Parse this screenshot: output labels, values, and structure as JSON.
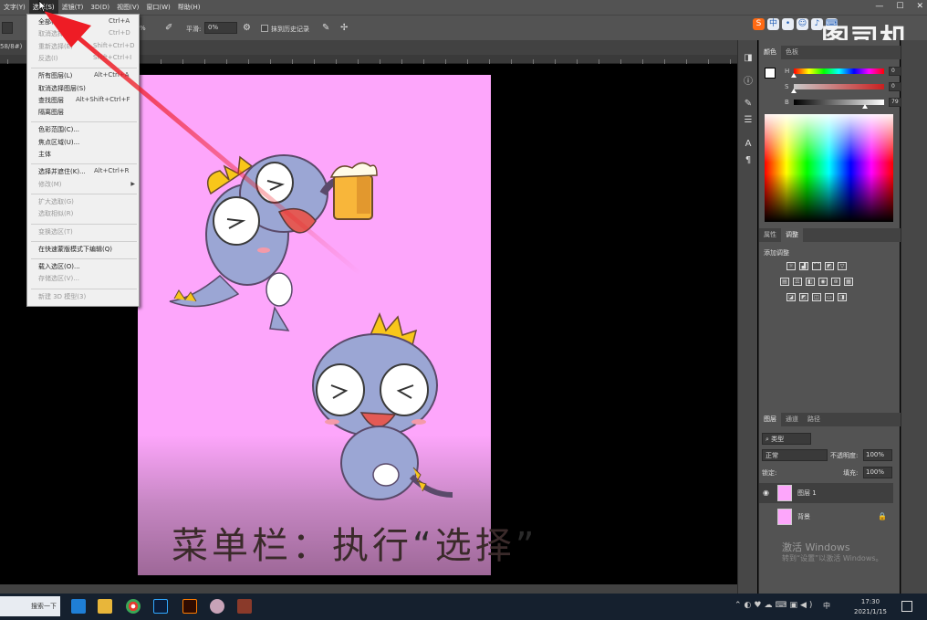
{
  "menubar": {
    "items": [
      "文字(Y)",
      "选择(S)",
      "滤镜(T)",
      "3D(D)",
      "视图(V)",
      "窗口(W)",
      "帮助(H)"
    ],
    "active_index": 1
  },
  "window_controls": [
    "—",
    "☐",
    "✕"
  ],
  "options_bar": {
    "percent_suffix": "%",
    "smoothing_label": "平滑:",
    "smoothing_value": "0%",
    "history_label": "抹到历史记录"
  },
  "doc_tab": "58/8#)",
  "watermark": "图司机",
  "select_menu": {
    "groups": [
      [
        {
          "label": "全部(A)",
          "shortcut": "Ctrl+A",
          "disabled": false
        },
        {
          "label": "取消选择(D)",
          "shortcut": "Ctrl+D",
          "disabled": true
        },
        {
          "label": "重新选择(E)",
          "shortcut": "Shift+Ctrl+D",
          "disabled": true
        },
        {
          "label": "反选(I)",
          "shortcut": "Shift+Ctrl+I",
          "disabled": true
        }
      ],
      [
        {
          "label": "所有图层(L)",
          "shortcut": "Alt+Ctrl+A",
          "disabled": false
        },
        {
          "label": "取消选择图层(S)",
          "shortcut": "",
          "disabled": false
        },
        {
          "label": "查找图层",
          "shortcut": "Alt+Shift+Ctrl+F",
          "disabled": false
        },
        {
          "label": "隔离图层",
          "shortcut": "",
          "disabled": false
        }
      ],
      [
        {
          "label": "色彩范围(C)...",
          "shortcut": "",
          "disabled": false
        },
        {
          "label": "焦点区域(U)...",
          "shortcut": "",
          "disabled": false
        },
        {
          "label": "主体",
          "shortcut": "",
          "disabled": false
        }
      ],
      [
        {
          "label": "选择并遮住(K)...",
          "shortcut": "Alt+Ctrl+R",
          "disabled": false
        },
        {
          "label": "修改(M)",
          "shortcut": "",
          "disabled": true,
          "submenu": true
        }
      ],
      [
        {
          "label": "扩大选取(G)",
          "shortcut": "",
          "disabled": true
        },
        {
          "label": "选取相似(R)",
          "shortcut": "",
          "disabled": true
        }
      ],
      [
        {
          "label": "变换选区(T)",
          "shortcut": "",
          "disabled": true
        }
      ],
      [
        {
          "label": "在快速蒙版模式下编辑(Q)",
          "shortcut": "",
          "disabled": false
        }
      ],
      [
        {
          "label": "载入选区(O)...",
          "shortcut": "",
          "disabled": false
        },
        {
          "label": "存储选区(V)...",
          "shortcut": "",
          "disabled": true
        }
      ],
      [
        {
          "label": "新建 3D 模型(3)",
          "shortcut": "",
          "disabled": true
        }
      ]
    ]
  },
  "caption": {
    "prefix": "菜单栏：执行",
    "open_quote": "“",
    "word": "选择",
    "close_quote": "”"
  },
  "color_panel": {
    "tabs": [
      "颜色",
      "色板"
    ],
    "channels": [
      {
        "label": "H",
        "value": "0",
        "unit": "°",
        "level": 0.0
      },
      {
        "label": "S",
        "value": "0",
        "unit": "%",
        "level": 0.0
      },
      {
        "label": "B",
        "value": "79",
        "unit": "%",
        "level": 0.79
      }
    ]
  },
  "adjust_panel": {
    "tabs": [
      "属性",
      "调整"
    ],
    "title": "添加调整"
  },
  "layers_panel": {
    "tabs": [
      "图层",
      "通道",
      "路径"
    ],
    "filter": "类型",
    "blend_mode": "正常",
    "opacity_label": "不透明度:",
    "opacity_value": "100%",
    "lock_label": "锁定:",
    "fill_label": "填充:",
    "fill_value": "100%",
    "layers": [
      {
        "name": "图层 1",
        "selected": true,
        "visible": true
      },
      {
        "name": "背景",
        "selected": false,
        "visible": false
      }
    ]
  },
  "windows_activation": {
    "title": "激活 Windows",
    "subtitle": "转到“设置”以激活 Windows。"
  },
  "taskbar": {
    "search_text": "搜索一下",
    "time": "17:30",
    "date": "2021/1/15",
    "ime": "中"
  },
  "colors": {
    "canvas_pink": "#fda6fb",
    "ui_gray": "#535353",
    "arrow_red": "#ee1c25"
  }
}
